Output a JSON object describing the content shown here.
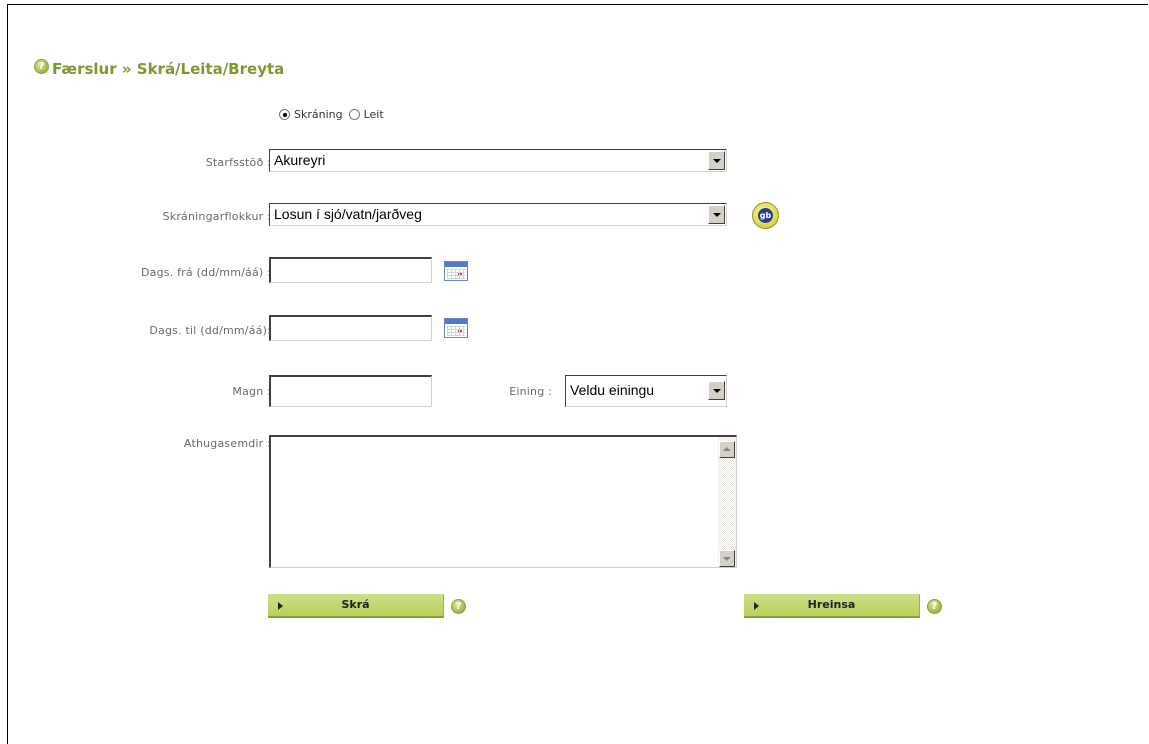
{
  "header": {
    "title": "Færslur » Skrá/Leita/Breyta"
  },
  "mode": {
    "options": [
      {
        "label": "Skráning",
        "checked": true
      },
      {
        "label": "Leit",
        "checked": false
      }
    ]
  },
  "form": {
    "station_label": "Starfsstöð :",
    "station_value": "Akureyri",
    "category_label": "Skráningarflokkur :",
    "category_value": "Losun í sjó/vatn/jarðveg",
    "date_from_label": "Dags. frá (dd/mm/áá) :",
    "date_from_value": "",
    "date_to_label": "Dags. til (dd/mm/áá):",
    "date_to_value": "",
    "amount_label": "Magn :",
    "amount_value": "",
    "unit_label": "Eining :",
    "unit_value": "Veldu einingu",
    "comments_label": "Athugasemdir :",
    "comments_value": ""
  },
  "actions": {
    "submit_label": "Skrá",
    "clear_label": "Hreinsa"
  },
  "icons": {
    "help": "help-icon",
    "calendar": "calendar-icon",
    "gb": "gb-icon",
    "gb_text": "gb"
  },
  "colors": {
    "title": "#7a9a2e",
    "button": "#c3d86e",
    "label": "#6a6a6a"
  }
}
